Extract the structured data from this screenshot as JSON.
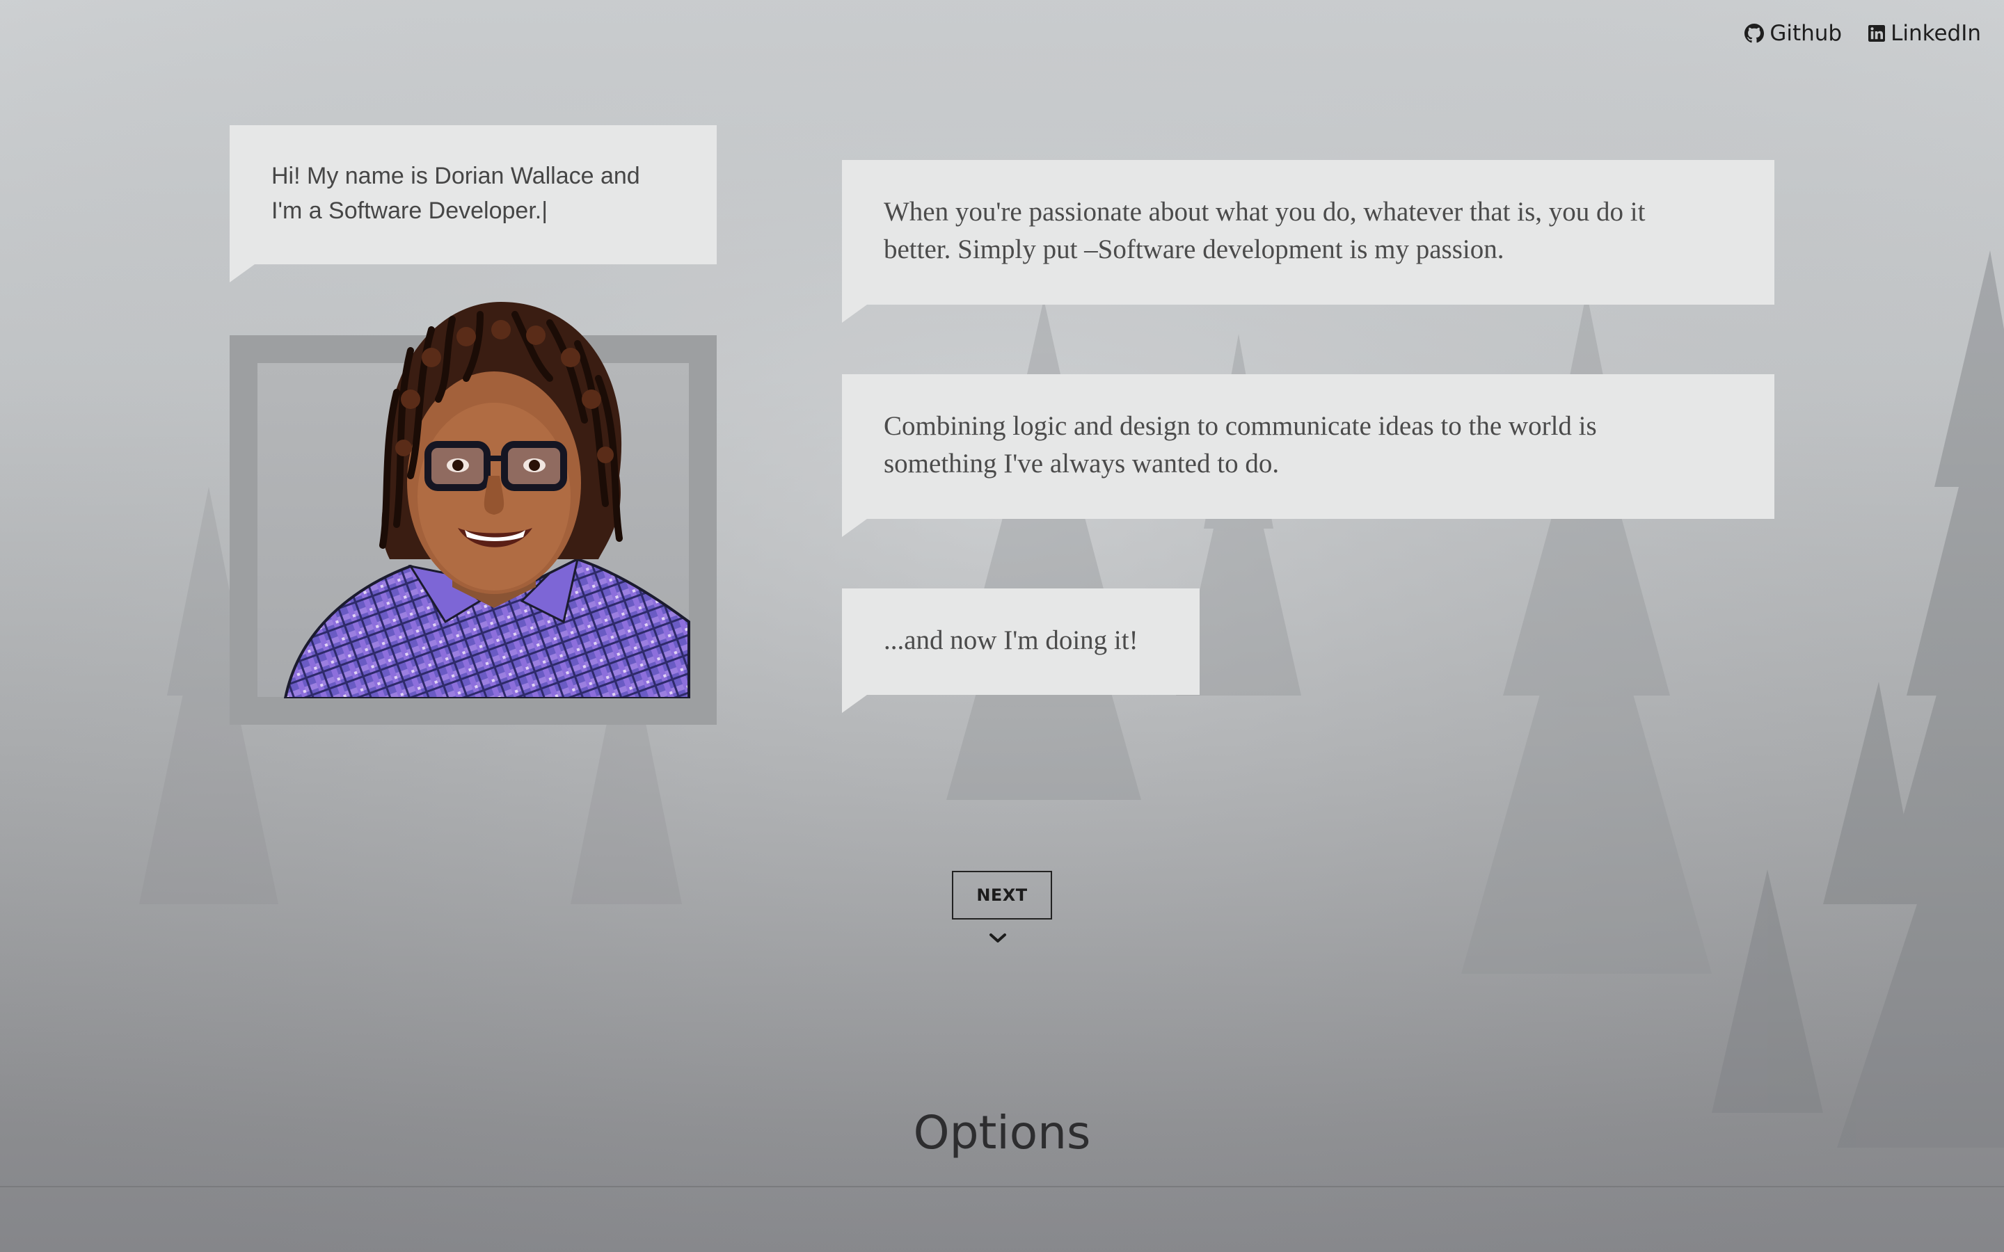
{
  "nav": {
    "github_label": "Github",
    "linkedin_label": "LinkedIn"
  },
  "intro_bubble": {
    "line1": "Hi! My name is Dorian Wallace and",
    "line2": "I'm a Software Developer.|"
  },
  "bubbles": {
    "passion_line1": "When you're passionate about what you do, whatever that is, you do it",
    "passion_line2": "better. Simply put –Software development is my passion.",
    "design_line1": "Combining logic and design to communicate ideas to the world is",
    "design_line2": "something I've always wanted to do.",
    "doing_it": "...and now I'm doing it!"
  },
  "next_button": {
    "label": "NEXT"
  },
  "section": {
    "title": "Options"
  },
  "icons": {
    "github": "github-icon",
    "linkedin": "linkedin-icon",
    "chevron": "chevron-down-icon"
  },
  "colors": {
    "bubble": "#e6e7e7",
    "text": "#4a4a4a",
    "frame": "#9d9fa1"
  }
}
